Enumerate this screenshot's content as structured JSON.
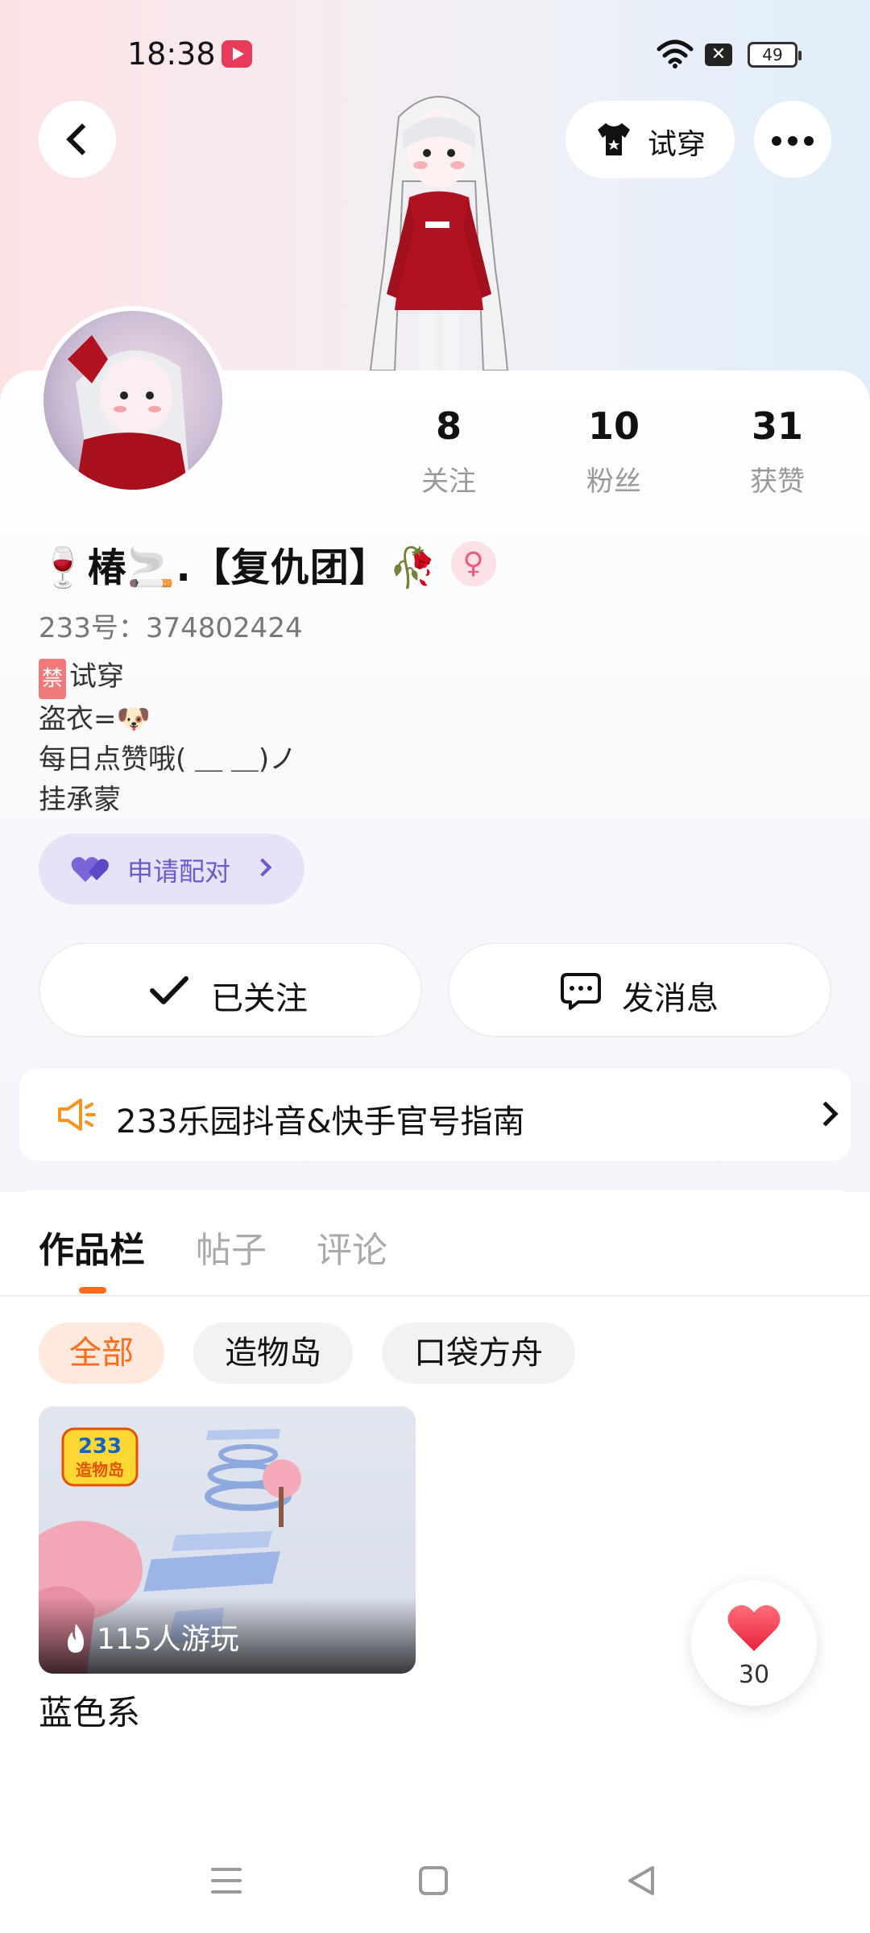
{
  "status_bar": {
    "time": "18:38",
    "battery": "49",
    "icons": [
      "screen-record-icon",
      "wifi-icon",
      "no-sim-icon",
      "battery-icon"
    ]
  },
  "header": {
    "tryon_label": "试穿"
  },
  "profile": {
    "nickname": "🍷椿🚬.【复仇团】🥀",
    "gender_symbol": "♀",
    "user_id": "233号：374802424",
    "bio_ban": "禁",
    "bio_line1": "试穿",
    "bio_line2": "盗衣=🐶",
    "bio_line3": "每日点赞哦( ＿ ＿)ノ",
    "bio_line4": "挂承蒙",
    "stats": [
      {
        "num": "8",
        "label": "关注"
      },
      {
        "num": "10",
        "label": "粉丝"
      },
      {
        "num": "31",
        "label": "获赞"
      }
    ],
    "match_label": "申请配对"
  },
  "actions": {
    "followed_label": "已关注",
    "message_label": "发消息"
  },
  "notice": {
    "text": "233乐园抖音&快手官号指南"
  },
  "tabs": [
    "作品栏",
    "帖子",
    "评论"
  ],
  "filters": [
    "全部",
    "造物岛",
    "口袋方舟"
  ],
  "game": {
    "badge_line1": "233",
    "badge_line2": "造物岛",
    "play_count": "115人游玩",
    "title": "蓝色系"
  },
  "like_fab": {
    "count": "30"
  },
  "colors": {
    "accent": "#ff6b1a",
    "match_purple": "#6a5acd",
    "like_red": "#f0455b"
  }
}
